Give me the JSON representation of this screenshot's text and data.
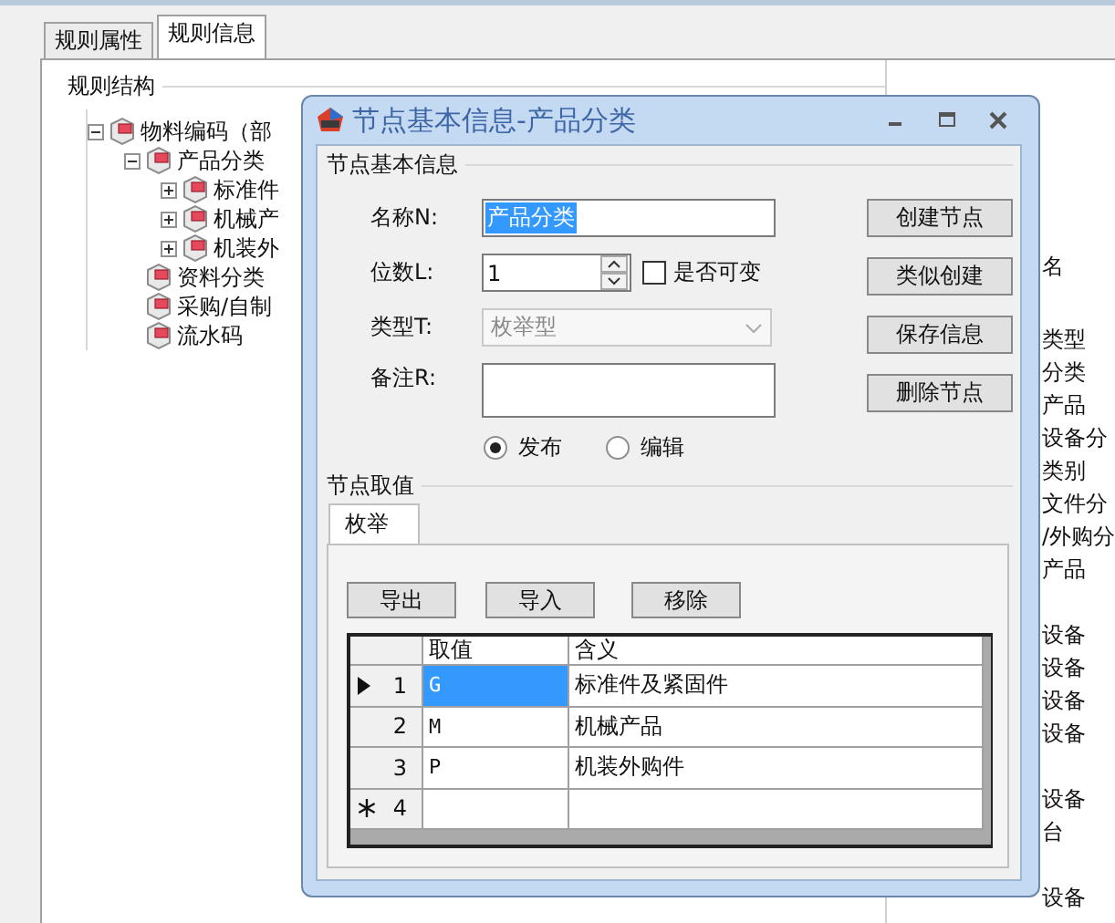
{
  "tabs": [
    {
      "label": "规则属性",
      "selected": false
    },
    {
      "label": "规则信息",
      "selected": true
    }
  ],
  "rule_structure": {
    "title": "规则结构",
    "tree": [
      {
        "label": "物料编码（部",
        "expanded": true,
        "children": [
          {
            "label": "产品分类",
            "expanded": true,
            "children": [
              {
                "label": "标准件",
                "expanded": false
              },
              {
                "label": "机械产",
                "expanded": false
              },
              {
                "label": "机装外",
                "expanded": false
              }
            ]
          },
          {
            "label": "资料分类"
          },
          {
            "label": "采购/自制"
          },
          {
            "label": "流水码"
          }
        ]
      }
    ]
  },
  "right_panel": {
    "groups": [
      [
        "名"
      ],
      [
        "类型",
        "分类",
        "产品",
        "设备分",
        "类别",
        "文件分",
        "/外购分",
        "产品"
      ],
      [
        "设备",
        "设备",
        "设备",
        "设备"
      ],
      [
        "设备",
        "台"
      ],
      [
        "设备"
      ]
    ]
  },
  "dialog": {
    "title": "节点基本信息-产品分类",
    "basic_info": {
      "title": "节点基本信息",
      "fields": [
        {
          "kind": "text",
          "label": "名称N:",
          "value": "产品分类",
          "selected": true
        },
        {
          "kind": "spin",
          "label": "位数L:",
          "value": "1"
        },
        {
          "kind": "combo",
          "label": "类型T:",
          "value": "枚举型",
          "disabled": true
        },
        {
          "kind": "textarea",
          "label": "备注R:"
        }
      ],
      "variable_checkbox": {
        "label": "是否可变",
        "checked": false
      },
      "radios": [
        {
          "label": "发布",
          "selected": true
        },
        {
          "label": "编辑",
          "selected": false
        }
      ],
      "buttons": [
        "创建节点",
        "类似创建",
        "保存信息",
        "删除节点"
      ]
    },
    "values": {
      "title": "节点取值",
      "tabs": [
        {
          "label": "枚举",
          "selected": true
        }
      ],
      "buttons": [
        "导出",
        "导入",
        "移除"
      ],
      "grid": {
        "columns": [
          "取值",
          "含义"
        ],
        "rows": [
          {
            "kind": "current",
            "number": "1",
            "cells": [
              "G",
              "标准件及紧固件"
            ],
            "selected": true
          },
          {
            "kind": "data",
            "number": "2",
            "cells": [
              "M",
              "机械产品"
            ],
            "selected": false
          },
          {
            "kind": "data",
            "number": "3",
            "cells": [
              "P",
              "机装外购件"
            ],
            "selected": false
          },
          {
            "kind": "new",
            "number": "4",
            "selected": false
          }
        ]
      }
    }
  }
}
